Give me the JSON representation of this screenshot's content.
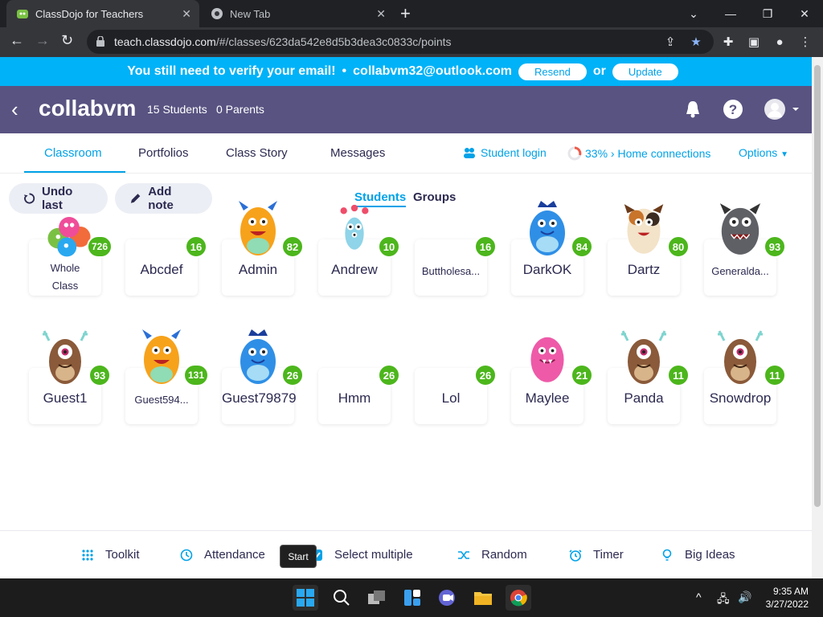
{
  "browser": {
    "tabs": [
      {
        "title": "ClassDojo for Teachers",
        "active": true
      },
      {
        "title": "New Tab",
        "active": false
      }
    ],
    "url_host": "teach.classdojo.com",
    "url_path": "/#/classes/623da542e8d5b3dea3c0833c/points"
  },
  "banner": {
    "message": "You still need to verify your email!",
    "bullet": "•",
    "email": "collabvm32@outlook.com",
    "resend_label": "Resend",
    "or_label": "or",
    "update_label": "Update"
  },
  "class_header": {
    "class_name": "collabvm",
    "students_count": "15 Students",
    "parents_count": "0 Parents"
  },
  "subnav": {
    "tabs": [
      "Classroom",
      "Portfolios",
      "Class Story",
      "Messages"
    ],
    "student_login": "Student login",
    "home_connections": "33% › Home connections",
    "options": "Options"
  },
  "actions": {
    "undo_label": "Undo last",
    "add_note_label": "Add note",
    "students_label": "Students",
    "groups_label": "Groups"
  },
  "students": [
    {
      "name": "Whole\nClass",
      "name_line1": "Whole",
      "name_line2": "Class",
      "points": "726",
      "avatar": "group-monsters"
    },
    {
      "name": "Abcdef",
      "points": "16",
      "avatar": "none"
    },
    {
      "name": "Admin",
      "points": "82",
      "avatar": "orange-monster"
    },
    {
      "name": "Andrew",
      "points": "10",
      "avatar": "blue-alien"
    },
    {
      "name": "Buttholesa...",
      "points": "16",
      "avatar": "none"
    },
    {
      "name": "DarkOK",
      "points": "84",
      "avatar": "blue-monster"
    },
    {
      "name": "Dartz",
      "points": "80",
      "avatar": "calico-monster"
    },
    {
      "name": "Generalda...",
      "points": "93",
      "avatar": "gray-monster"
    },
    {
      "name": "Guest1",
      "points": "93",
      "avatar": "brown-cyclops"
    },
    {
      "name": "Guest594...",
      "points": "131",
      "avatar": "orange-monster"
    },
    {
      "name": "Guest79879",
      "points": "26",
      "avatar": "blue-monster"
    },
    {
      "name": "Hmm",
      "points": "26",
      "avatar": "none"
    },
    {
      "name": "Lol",
      "points": "26",
      "avatar": "none"
    },
    {
      "name": "Maylee",
      "points": "21",
      "avatar": "pink-monster"
    },
    {
      "name": "Panda",
      "points": "11",
      "avatar": "brown-cyclops"
    },
    {
      "name": "Snowdrop",
      "points": "11",
      "avatar": "brown-cyclops"
    }
  ],
  "bottom_toolbar": {
    "toolkit": "Toolkit",
    "attendance": "Attendance",
    "select_multiple": "Select multiple",
    "random": "Random",
    "timer": "Timer",
    "big_ideas": "Big Ideas"
  },
  "tooltip": "Start",
  "taskbar": {
    "time": "9:35 AM",
    "date": "3/27/2022"
  },
  "colors": {
    "banner": "#00b2f7",
    "header": "#585381",
    "accent": "#00a2e8",
    "badge": "#4cb61c",
    "text": "#2c2a50"
  }
}
